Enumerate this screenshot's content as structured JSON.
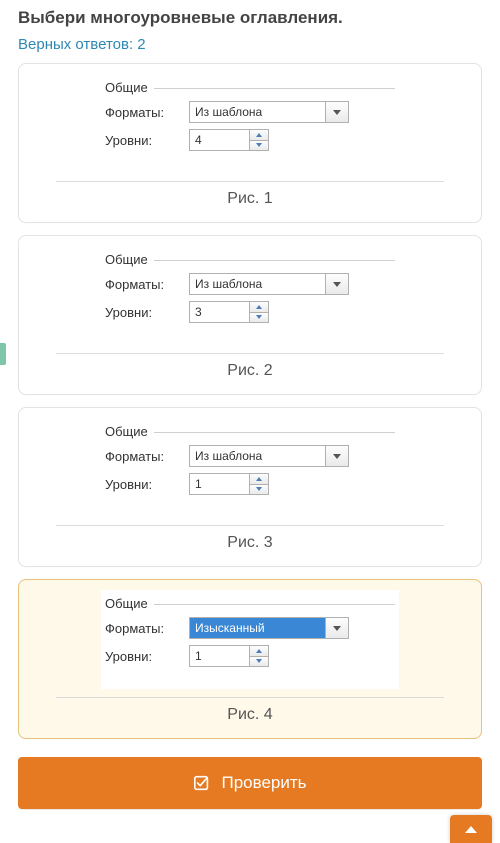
{
  "question": "Выбери многоуровневые оглавления.",
  "correct_text": "Верных ответов: 2",
  "group_label": "Общие",
  "labels": {
    "formats": "Форматы:",
    "levels": "Уровни:"
  },
  "options": [
    {
      "format": "Из шаблона",
      "levels": "4",
      "caption": "Рис. 1",
      "highlighted": false
    },
    {
      "format": "Из шаблона",
      "levels": "3",
      "caption": "Рис. 2",
      "highlighted": false
    },
    {
      "format": "Из шаблона",
      "levels": "1",
      "caption": "Рис. 3",
      "highlighted": false
    },
    {
      "format": "Изысканный",
      "levels": "1",
      "caption": "Рис. 4",
      "highlighted": true
    }
  ],
  "check_button": "Проверить"
}
